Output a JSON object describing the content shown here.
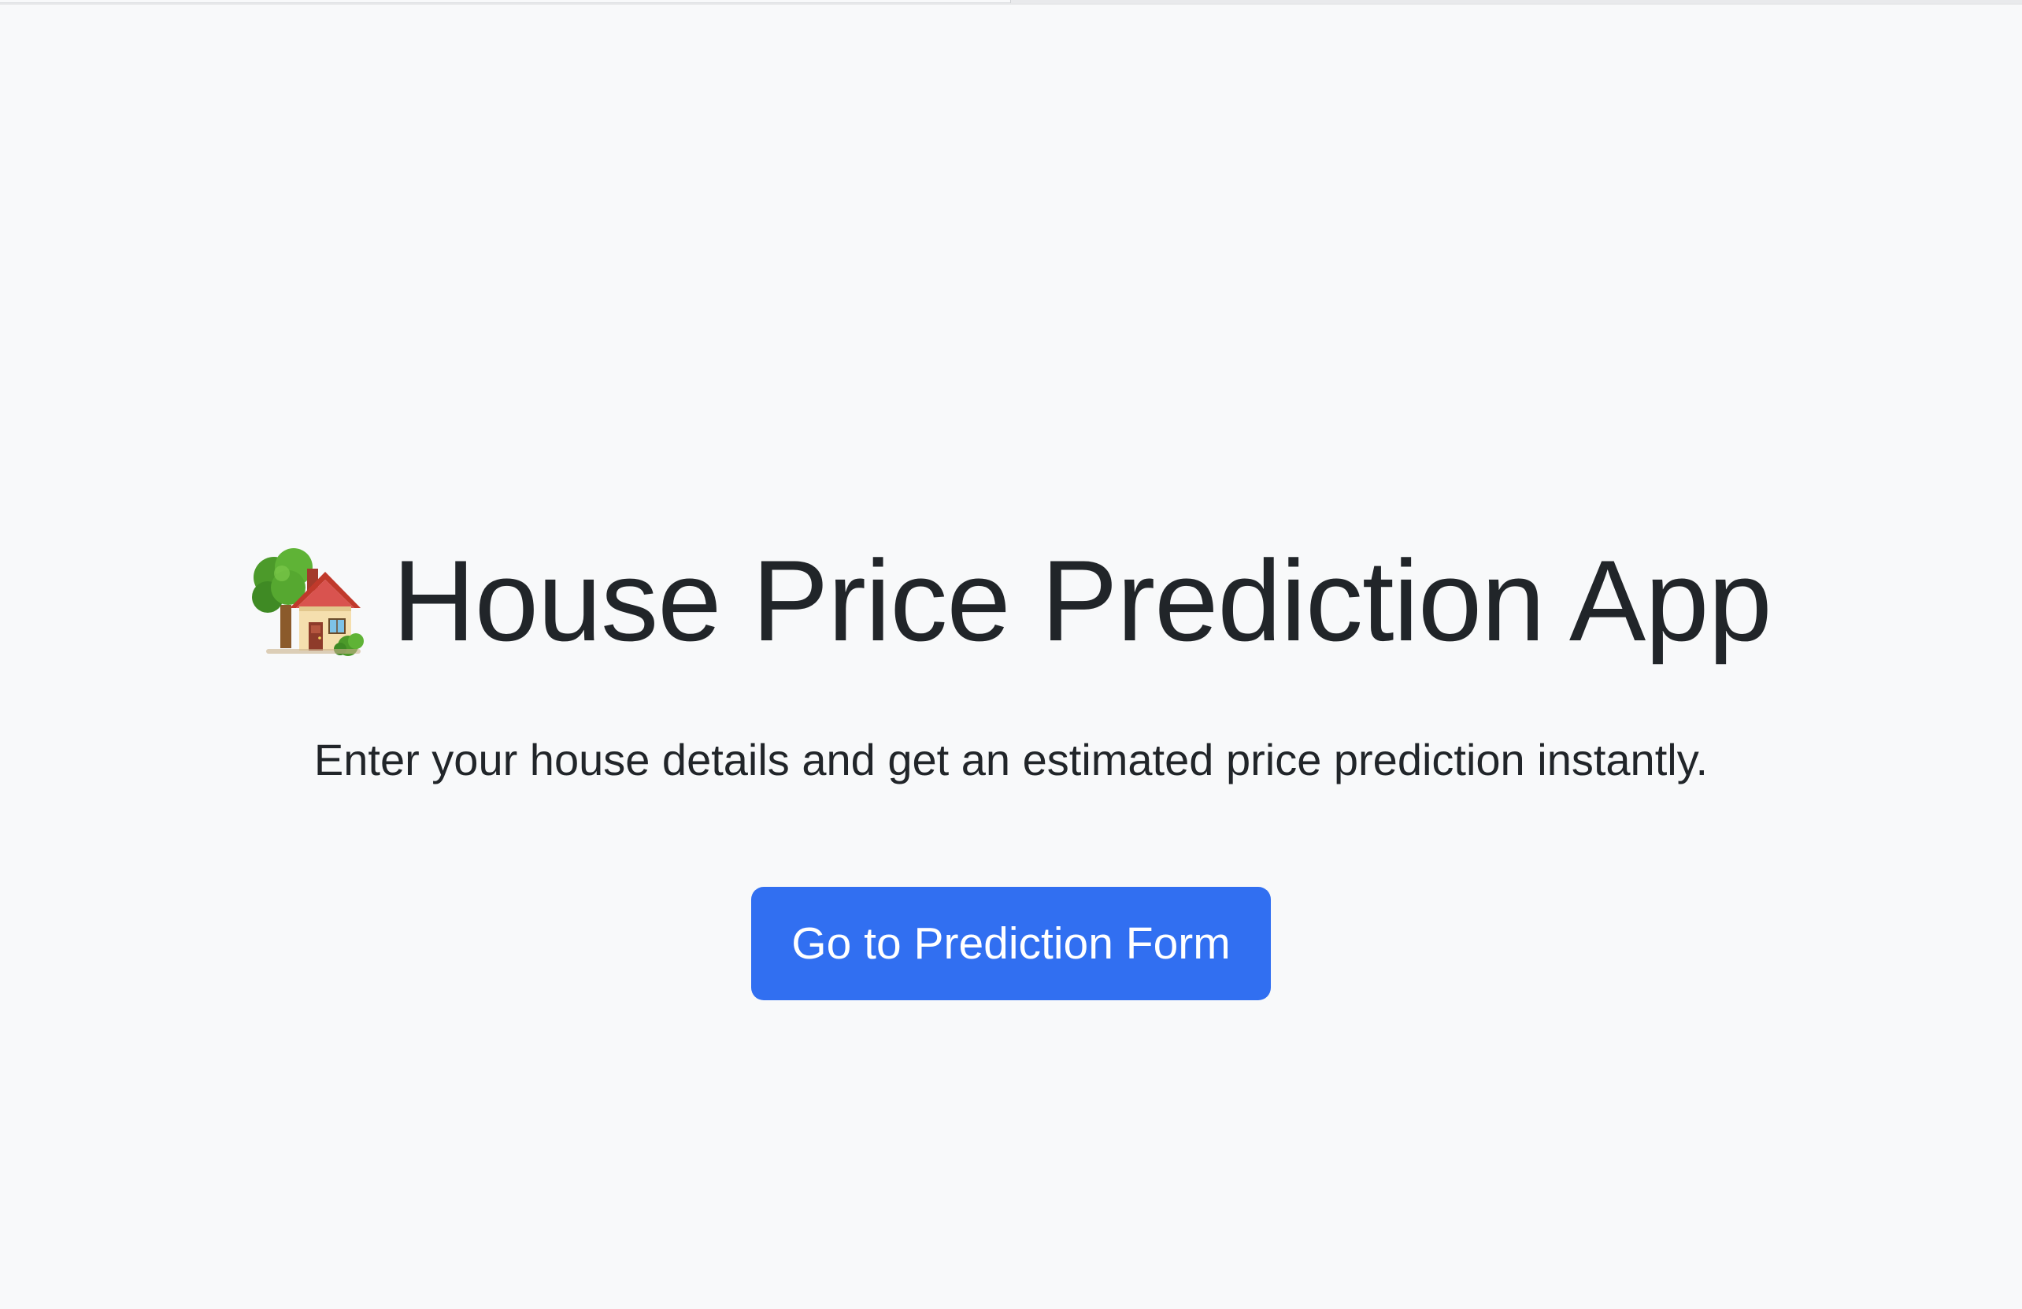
{
  "hero": {
    "icon": "house-with-garden-icon",
    "title": "House Price Prediction App",
    "subtitle": "Enter your house details and get an estimated price prediction instantly.",
    "cta_label": "Go to Prediction Form"
  },
  "colors": {
    "background": "#f8f9fa",
    "text": "#212529",
    "primary_button": "#316ff1",
    "button_text": "#ffffff"
  }
}
